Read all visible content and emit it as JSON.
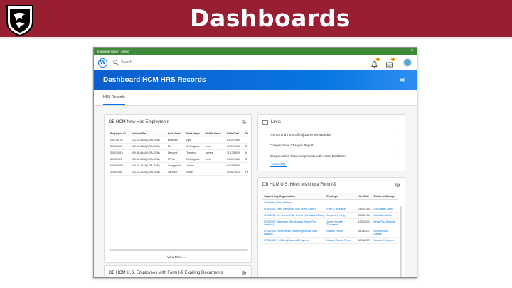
{
  "slide": {
    "title": "Dashboards"
  },
  "window": {
    "title": "Implementation - wsu1",
    "close_glyph": "×"
  },
  "topbar": {
    "logo_letter": "W",
    "search_placeholder": "Search"
  },
  "dashboard": {
    "title": "Dashboard HCM HRS Records",
    "tab": "HRS Records"
  },
  "new_hire": {
    "title": "DB HCM New Hire Employment",
    "columns": [
      "Employee ID",
      "National IDs",
      "Last Name",
      "First Name",
      "Middle Name",
      "Birth Date",
      "Gend"
    ],
    "rows": [
      [
        "011745132",
        "222-22-4000 (USA-SSN)",
        "Borboski",
        "Kyle",
        "",
        "03/14/1980",
        ""
      ],
      [
        "30000163",
        "000-00-0426 (USA-SSN)",
        "Bill",
        "BetElligAck",
        "Forth",
        "01/01/1980",
        "Of Dt"
      ],
      [
        "300079119",
        "509-86-6844 (USA-SSN)",
        "Demarol",
        "Timothy",
        "James",
        "11/17/1979",
        "M"
      ],
      [
        "30000161",
        "000-00-0438 (USA-SSN)",
        "FTFail",
        "BetElligAck",
        "Forth",
        "01/01/1980",
        "Of Dt"
      ],
      [
        "000000954",
        "545-54-4123 (USA-SSN)",
        "Ganggoodo",
        "Jimmy",
        "",
        "04/11/1990",
        ""
      ],
      [
        "30000165",
        "222-23-2220 (USA-SSN)",
        "Garrison",
        "Mister",
        "",
        "02/02/1972",
        "F M"
      ]
    ],
    "view_more": "View More ..."
  },
  "links": {
    "title": "Links",
    "items": [
      "Accrual and Time Off Adjustments/Overrides",
      "Compensation Changes Report",
      "Compensation Plan Assignments with Actual End Dates"
    ],
    "more": "More (10)",
    "chevron": "›"
  },
  "i9_missing": {
    "title": "DB HCM U.S. Hires Missing a Form I-9",
    "columns": [
      "Supervisory Organization",
      "Employee",
      "Hire Date",
      "Worker's Manager"
    ],
    "rows": [
      [
        "Chemistry (John Peters)",
        "",
        "",
        ""
      ],
      [
        "SP003541 Plant Pathology (Lori Marie Carris)",
        "Ellen S Johnston",
        "03/01/1993",
        "Lori Marie Carris"
      ],
      [
        "SP002231 Mt. Vernon R&E Center (Carol Ann Miles)",
        "Jacqueline King",
        "05/01/1994",
        "Carol Ann Miles"
      ],
      [
        "SP002257 Veterinary Microbiology (Kevin Roy Snekvik)",
        "James Bradley Thompson",
        "12/20/2004",
        "Kevin Roy Snekvik"
      ],
      [
        "SP002604 Performance Nutrition (Michael Alan Hayton)",
        "Balram Pande",
        "06/18/2007",
        "Michael Alan Hayton"
      ],
      [
        "SP001489 Tri-Cities (Sandra D Haynes)",
        "Manuel Garcia Perez",
        "08/16/2007",
        "Sandra D Haynes"
      ]
    ]
  },
  "expiring": {
    "title": "DB HCM U.S. Employees with Form I-9 Expiring Documents"
  },
  "colors": {
    "brand": "#981e32",
    "workday_blue": "#0875e1",
    "window_green": "#3f8a39",
    "badge": "#f38b00"
  }
}
